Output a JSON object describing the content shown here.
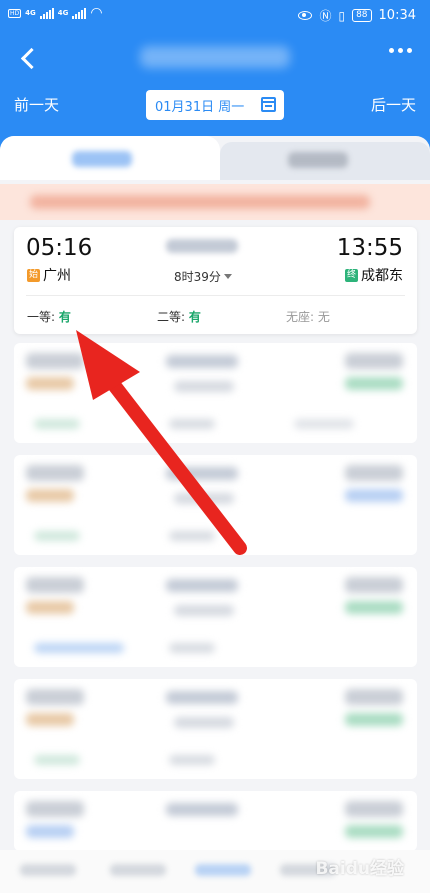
{
  "nav": {
    "prev_day": "前一天",
    "next_day": "后一天",
    "date": "01月31日 周一"
  },
  "status": {
    "time": "10:34",
    "battery": "88",
    "net1": "4G",
    "net2": "4G"
  },
  "train": {
    "departure_time": "05:16",
    "arrival_time": "13:55",
    "from_badge": "始",
    "from_station": "广州",
    "to_badge": "终",
    "to_station": "成都东",
    "duration": "8时39分",
    "seats": [
      {
        "label": "一等: ",
        "value": "有"
      },
      {
        "label": "二等: ",
        "value": "有"
      },
      {
        "label": "无座: ",
        "value": "无"
      }
    ]
  },
  "watermark": "Baidu经验",
  "colors": {
    "primary": "#2b8bf4",
    "available": "#1aa66a",
    "start_badge": "#f39a2b",
    "end_badge": "#2db37a",
    "arrow": "#e8251f"
  }
}
